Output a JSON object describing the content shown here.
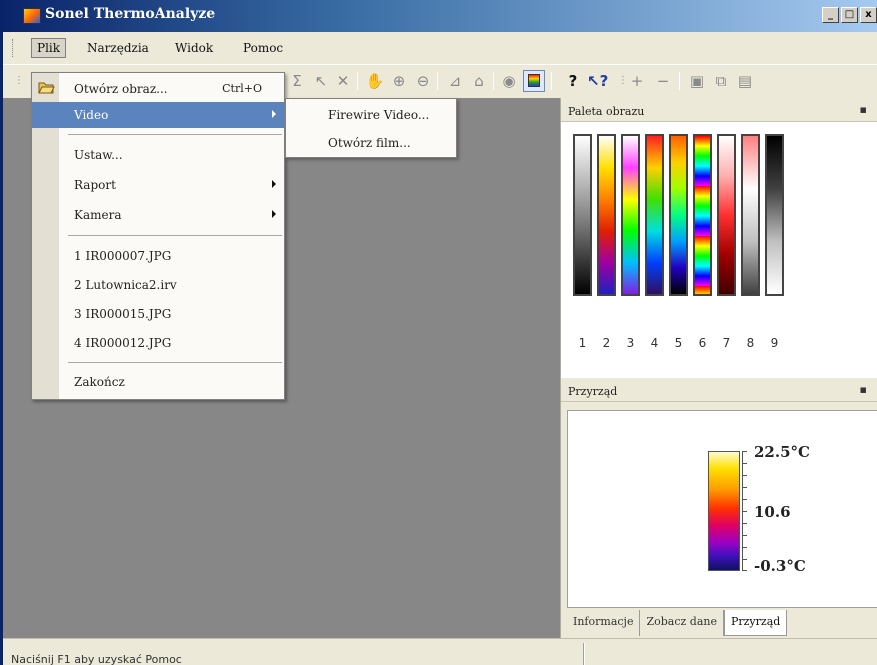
{
  "window": {
    "title": "Sonel ThermoAnalyze",
    "controls": [
      "_",
      "□",
      "x"
    ]
  },
  "menubar": {
    "items": [
      {
        "label": "Plik"
      },
      {
        "label": "Narzędzia"
      },
      {
        "label": "Widok"
      },
      {
        "label": "Pomoc"
      }
    ]
  },
  "file_menu": {
    "open": {
      "label": "Otwórz obraz...",
      "shortcut": "Ctrl+O"
    },
    "video": {
      "label": "Video"
    },
    "settings": {
      "label": "Ustaw..."
    },
    "report": {
      "label": "Raport"
    },
    "camera": {
      "label": "Kamera"
    },
    "recent": [
      {
        "label": "1 IR000007.JPG"
      },
      {
        "label": "2 Lutownica2.irv"
      },
      {
        "label": "3 IR000015.JPG"
      },
      {
        "label": "4 IR000012.JPG"
      }
    ],
    "exit": {
      "label": "Zakończ"
    }
  },
  "video_submenu": {
    "items": [
      {
        "label": "Firewire Video..."
      },
      {
        "label": "Otwórz film..."
      }
    ]
  },
  "palette_panel": {
    "title": "Paleta obrazu",
    "pin": "ᵖ",
    "palette_numbers": [
      "1",
      "2",
      "3",
      "4",
      "5",
      "6",
      "7",
      "8",
      "9"
    ]
  },
  "instrument_panel": {
    "title": "Przyrząd",
    "pin": "ᵖ",
    "scale_max": "22.5°C",
    "scale_mid": "10.6",
    "scale_min": "-0.3°C"
  },
  "tabs": [
    {
      "label": "Informacje"
    },
    {
      "label": "Zobacz dane"
    },
    {
      "label": "Przyrząd"
    }
  ],
  "statusbar": {
    "text": "Naciśnij F1 aby uzyskać Pomoc"
  },
  "colors": {
    "titlebar_start": "#0a246a",
    "menu_highlight": "#5b83bd",
    "workspace": "#878787"
  }
}
